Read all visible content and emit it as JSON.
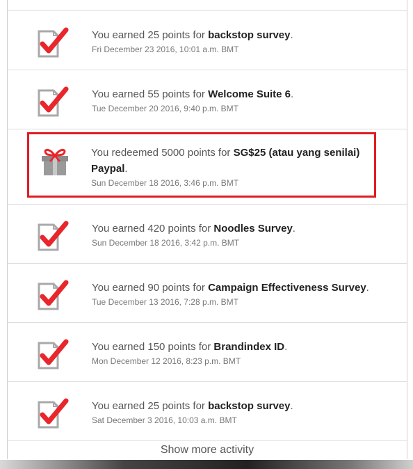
{
  "activity": [
    {
      "prefix": "You earned 25 points for",
      "target": "backstop survey",
      "suffix": ".",
      "date": "Fri December 23 2016, 10:01 a.m. BMT",
      "icon": "checklist-icon"
    },
    {
      "prefix": "You earned 55 points for",
      "target": "Welcome Suite 6",
      "suffix": ".",
      "date": "Tue December 20 2016, 9:40 p.m. BMT",
      "icon": "checklist-icon"
    },
    {
      "prefix": "You redeemed 5000 points for",
      "target": "SG$25 (atau yang senilai) Paypal",
      "suffix": ".",
      "date": "Sun December 18 2016, 3:46 p.m. BMT",
      "icon": "gift-icon",
      "highlighted": true
    },
    {
      "prefix": "You earned 420 points for",
      "target": "Noodles Survey",
      "suffix": ".",
      "date": "Sun December 18 2016, 3:42 p.m. BMT",
      "icon": "checklist-icon"
    },
    {
      "prefix": "You earned 90 points for",
      "target": "Campaign Effectiveness Survey",
      "suffix": ".",
      "date": "Tue December 13 2016, 7:28 p.m. BMT",
      "icon": "checklist-icon"
    },
    {
      "prefix": "You earned 150 points for",
      "target": "Brandindex ID",
      "suffix": ".",
      "date": "Mon December 12 2016, 8:23 p.m. BMT",
      "icon": "checklist-icon"
    },
    {
      "prefix": "You earned 25 points for",
      "target": "backstop survey",
      "suffix": ".",
      "date": "Sat December 3 2016, 10:03 a.m. BMT",
      "icon": "checklist-icon"
    }
  ],
  "show_more_label": "Show more activity",
  "colors": {
    "check": "#e8262b",
    "highlight_border": "#e11b22",
    "gift_ribbon": "#e8262b",
    "gift_box": "#8c8c8c"
  }
}
